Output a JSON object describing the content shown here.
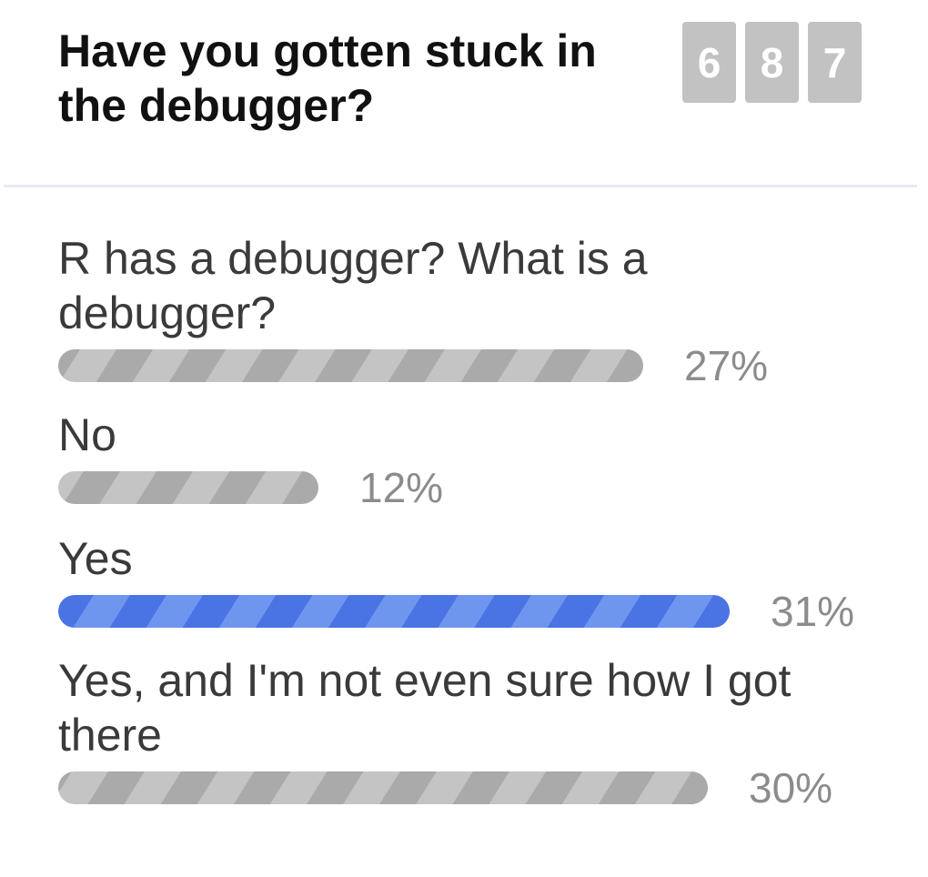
{
  "poll": {
    "question": "Have you gotten stuck in the debugger?",
    "vote_count_digits": [
      "6",
      "8",
      "7"
    ],
    "options": [
      {
        "label": "R has a debugger? What is a debugger?",
        "percent_label": "27%",
        "percent": 27,
        "selected": false
      },
      {
        "label": "No",
        "percent_label": "12%",
        "percent": 12,
        "selected": false
      },
      {
        "label": "Yes",
        "percent_label": "31%",
        "percent": 31,
        "selected": true
      },
      {
        "label": "Yes, and I'm not even sure how I got there",
        "percent_label": "30%",
        "percent": 30,
        "selected": false
      }
    ]
  },
  "colors": {
    "bar_default": "#b3b3b3",
    "bar_selected": "#4a73e4",
    "counter_bg": "#c2c2c2",
    "divider": "#e3eaf3"
  }
}
